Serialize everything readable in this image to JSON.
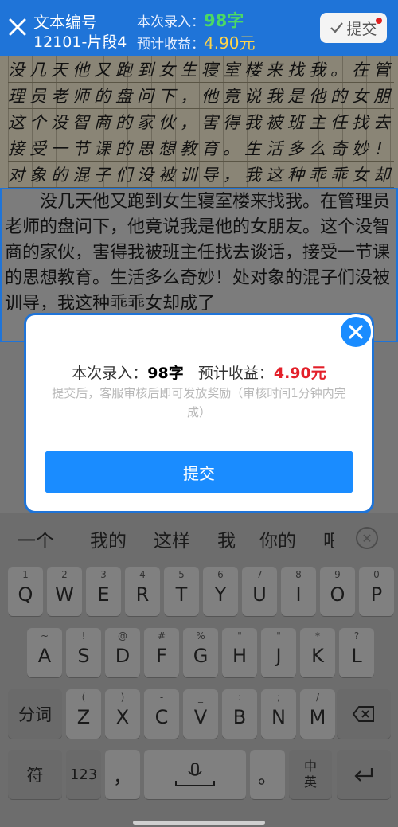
{
  "header": {
    "title_line1": "文本编号",
    "title_line2": "12101-片段4",
    "count_label": "本次录入：",
    "count_value": "98字",
    "income_label": "预计收益：",
    "income_value": "4.90元",
    "submit_label": "提交"
  },
  "handwriting": {
    "lines": [
      "没几天他又跑到女生寝室楼来找我。在管",
      "理员老师的盘问下，他竟说我是他的女朋友。",
      "这个没智商的家伙，害得我被班主任找去谈话，",
      "接受一节课的思想教育。生活多么奇妙！处",
      "对象的混子们没被训导，我这种乖乖女却成了"
    ]
  },
  "typed_text": "没几天他又跑到女生寝室楼来找我。在管理员老师的盘问下，他竟说我是他的女朋友。这个没智商的家伙，害得我被班主任找去谈话，接受一节课的思想教育。生活多么奇妙！处对象的混子们没被训导，我这种乖乖女却成了",
  "modal": {
    "count_label": "本次录入：",
    "count_value": "98字",
    "income_label": "预计收益：",
    "income_value": "4.90元",
    "note": "提交后，客服审核后即可发放奖励（审核时间1分钟内完成）",
    "submit_label": "提交"
  },
  "keyboard": {
    "candidates": [
      "一个",
      "我的",
      "这样",
      "我",
      "你的",
      "吧"
    ],
    "row1": [
      {
        "main": "Q",
        "sup": "1"
      },
      {
        "main": "W",
        "sup": "2"
      },
      {
        "main": "E",
        "sup": "3"
      },
      {
        "main": "R",
        "sup": "4"
      },
      {
        "main": "T",
        "sup": "5"
      },
      {
        "main": "Y",
        "sup": "6"
      },
      {
        "main": "U",
        "sup": "7"
      },
      {
        "main": "I",
        "sup": "8"
      },
      {
        "main": "O",
        "sup": "9"
      },
      {
        "main": "P",
        "sup": "0"
      }
    ],
    "row2": [
      {
        "main": "A",
        "sup": "~"
      },
      {
        "main": "S",
        "sup": "!"
      },
      {
        "main": "D",
        "sup": "@"
      },
      {
        "main": "F",
        "sup": "#"
      },
      {
        "main": "G",
        "sup": "%"
      },
      {
        "main": "H",
        "sup": "\""
      },
      {
        "main": "J",
        "sup": "\""
      },
      {
        "main": "K",
        "sup": "*"
      },
      {
        "main": "L",
        "sup": "?"
      }
    ],
    "row3": [
      {
        "main": "Z",
        "sup": "("
      },
      {
        "main": "X",
        "sup": ")"
      },
      {
        "main": "C",
        "sup": "-"
      },
      {
        "main": "V",
        "sup": "_"
      },
      {
        "main": "B",
        "sup": ":"
      },
      {
        "main": "N",
        "sup": ";"
      },
      {
        "main": "M",
        "sup": "/"
      }
    ],
    "fenci_label": "分词",
    "symbol_label": "符",
    "num_label": "123",
    "comma_label": "，",
    "period_label": "。",
    "lang_top": "中",
    "lang_bottom": "英"
  },
  "colors": {
    "brand_blue": "#1f74d8",
    "button_blue": "#1a8cff",
    "count_green": "#4cd964",
    "income_yellow": "#ffd54a",
    "income_red": "#e3202a"
  },
  "icons": [
    "close-icon",
    "check-icon",
    "modal-close-icon",
    "backspace-icon",
    "microphone-icon",
    "enter-icon",
    "candidate-close-icon"
  ]
}
